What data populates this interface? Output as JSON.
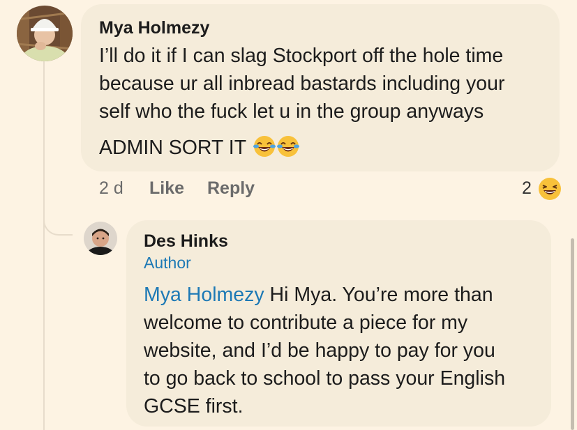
{
  "comment": {
    "author": "Mya Holmezy",
    "lines": [
      "I’ll do it if I can slag Stockport off the hole time",
      "because ur all inbread bastards including your",
      "self who the fuck let u in the group anyways"
    ],
    "last_line": "ADMIN SORT IT",
    "inline_emoji": [
      "face-with-tears-of-joy-icon",
      "face-with-tears-of-joy-icon"
    ],
    "timestamp": "2 d",
    "like_label": "Like",
    "reply_label": "Reply",
    "reaction_count": "2",
    "reaction_icon": "laughing-face-icon"
  },
  "reply": {
    "author": "Des Hinks",
    "badge": "Author",
    "mention": "Mya Holmezy",
    "first_line_rest": " Hi Mya. You’re more than",
    "lines": [
      "welcome to contribute a piece for my",
      "website, and I’d be happy to pay for you",
      "to go back to school to pass your English",
      "GCSE first."
    ]
  },
  "colors": {
    "background": "#fdf3e3",
    "bubble": "#f5ecda",
    "mention": "#1d79b5",
    "muted_text": "#6b6b6b"
  }
}
